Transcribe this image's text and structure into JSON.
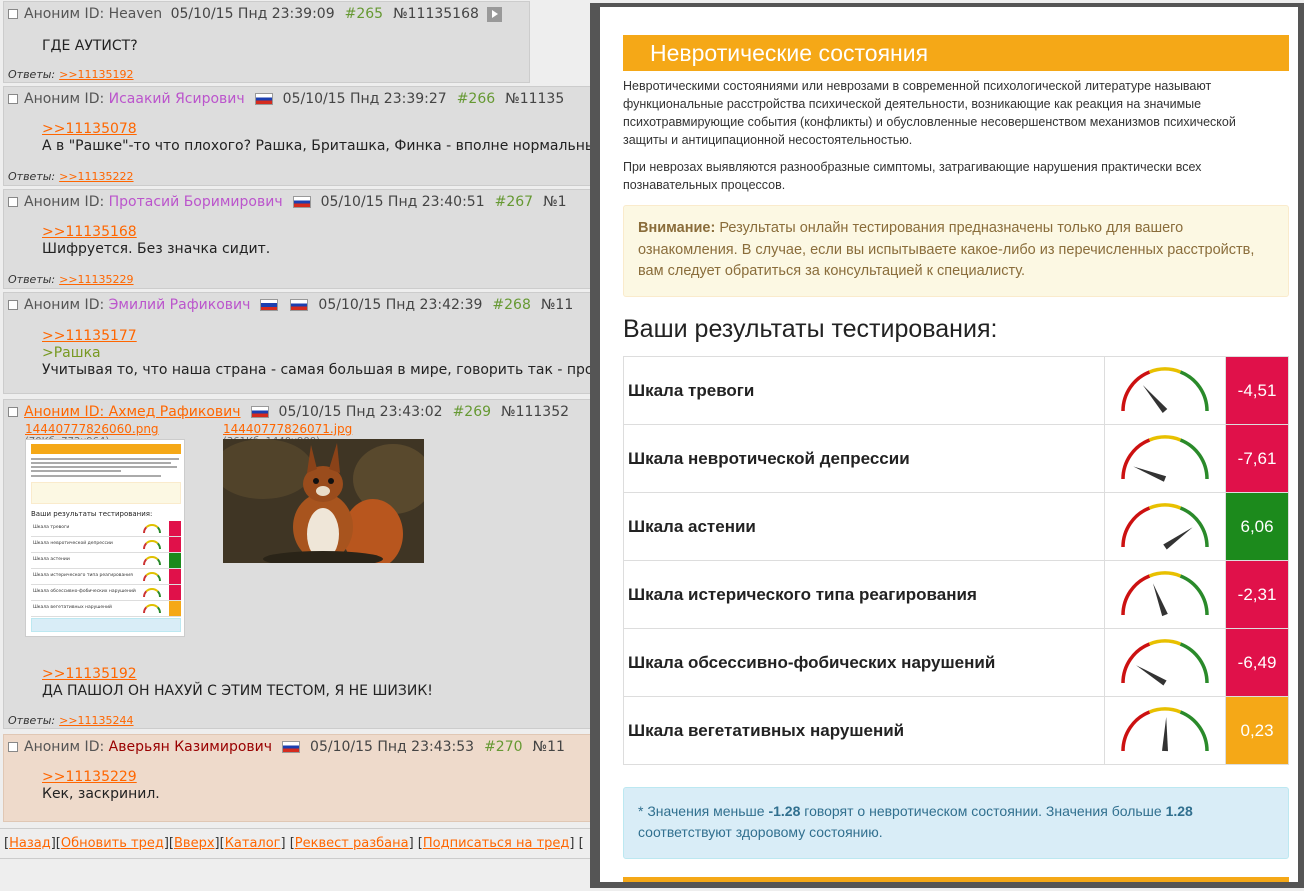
{
  "posts": [
    {
      "author": "Аноним ID: Heaven",
      "datetime": "05/10/15 Пнд 23:39:09",
      "number": "#265",
      "id": "№11135168",
      "lines": [
        "ГДЕ АУТИСТ?"
      ],
      "replies_label": "Ответы:",
      "replies": ">>11135192"
    },
    {
      "author_prefix": "Аноним ID:",
      "author_name": "Исаакий Ясирович",
      "datetime": "05/10/15 Пнд 23:39:27",
      "number": "#266",
      "id": "№11135",
      "reply_link": ">>11135078",
      "lines": [
        "А в \"Рашке\"-то что плохого? Рашка, Бриташка, Финка - вполне нормальны"
      ],
      "replies_label": "Ответы:",
      "replies": ">>11135222"
    },
    {
      "author_prefix": "Аноним ID:",
      "author_name": "Протасий Боримирович",
      "datetime": "05/10/15 Пнд 23:40:51",
      "number": "#267",
      "id": "№1",
      "reply_link": ">>11135168",
      "lines": [
        "Шифруется. Без значка сидит."
      ],
      "replies_label": "Ответы:",
      "replies": ">>11135229"
    },
    {
      "author_prefix": "Аноним ID:",
      "author_name": "Эмилий Рафикович",
      "datetime": "05/10/15 Пнд 23:42:39",
      "number": "#268",
      "id": "№11",
      "reply_link": ">>11135177",
      "greentext": ">Рашка",
      "lines": [
        "Учитывая то, что наша страна - самая большая в мире, говорить так - про"
      ]
    },
    {
      "author": "Аноним ID: Ахмед Рафикович",
      "datetime": "05/10/15 Пнд 23:43:02",
      "number": "#269",
      "id": "№111352",
      "files": [
        {
          "name": "14440777826060.png",
          "meta": "(70Кб, 772x964)"
        },
        {
          "name": "14440777826071.jpg",
          "meta": "(361Кб, 1440x900)"
        }
      ],
      "reply_link": ">>11135192",
      "lines": [
        "ДА ПАШОЛ ОН НАХУЙ С ЭТИМ ТЕСТОМ, Я НЕ ШИЗИК!"
      ],
      "replies_label": "Ответы:",
      "replies": ">>11135244"
    },
    {
      "author_prefix": "Аноним ID:",
      "author_name": "Аверьян Казимирович",
      "datetime": "05/10/15 Пнд 23:43:53",
      "number": "#270",
      "id": "№11",
      "reply_link": ">>11135229",
      "lines": [
        "Кек, заскринил."
      ]
    }
  ],
  "footer": {
    "back": "Назад",
    "refresh": "Обновить тред",
    "up": "Вверх",
    "catalog": "Каталог",
    "request": "Реквест разбана",
    "subscribe": "Подписаться на тред"
  },
  "overlay": {
    "title": "Невротические состояния",
    "para1": "Невротическими состояниями или неврозами в современной психологической литературе называют функциональные расстройства психической деятельности, возникающие как реакция на значимые психотравмирующие события (конфликты) и обусловленные несовершенством механизмов психической защиты и антиципационной несостоятельностью.",
    "para2": "При неврозах выявляются разнообразные симптомы, затрагивающие нарушения практически всех познавательных процессов.",
    "warning_label": "Внимание:",
    "warning_text": "Результаты онлайн тестирования предназначены только для вашего ознакомления. В случае, если вы испытываете какое-либо из перечисленных расстройств, вам следует обратиться за консультацией к специалисту.",
    "results_heading": "Ваши результаты тестирования:",
    "scales": [
      {
        "name": "Шкала тревоги",
        "value": "-4,51",
        "num": -4.51,
        "color": "#e0114a"
      },
      {
        "name": "Шкала невротической депрессии",
        "value": "-7,61",
        "num": -7.61,
        "color": "#e0114a"
      },
      {
        "name": "Шкала астении",
        "value": "6,06",
        "num": 6.06,
        "color": "#1c8a1c"
      },
      {
        "name": "Шкала истерического типа реагирования",
        "value": "-2,31",
        "num": -2.31,
        "color": "#e0114a"
      },
      {
        "name": "Шкала обсессивно-фобических нарушений",
        "value": "-6,49",
        "num": -6.49,
        "color": "#e0114a"
      },
      {
        "name": "Шкала вегетативных нарушений",
        "value": "0,23",
        "num": 0.23,
        "color": "#f5a817"
      }
    ],
    "note_prefix": "* Значения меньше",
    "note_low": "-1.28",
    "note_mid": "говорят о невротическом состоянии. Значения больше",
    "note_high": "1.28",
    "note_end": "соответствуют здоровому состоянию."
  }
}
